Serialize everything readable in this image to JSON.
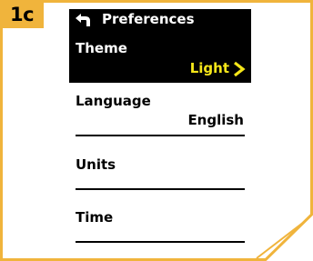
{
  "badge": {
    "label": "1c",
    "color": "#f0b43c"
  },
  "header": {
    "title": "Preferences",
    "back_icon": "back-arrow-icon"
  },
  "settings": [
    {
      "label": "Theme",
      "value": "Light",
      "selected": true
    },
    {
      "label": "Language",
      "value": "English",
      "selected": false
    },
    {
      "label": "Units",
      "value": "",
      "selected": false
    },
    {
      "label": "Time",
      "value": "",
      "selected": false
    }
  ],
  "colors": {
    "frame": "#f0b43c",
    "highlight_text": "#f5e619",
    "selected_bg": "#000000"
  }
}
